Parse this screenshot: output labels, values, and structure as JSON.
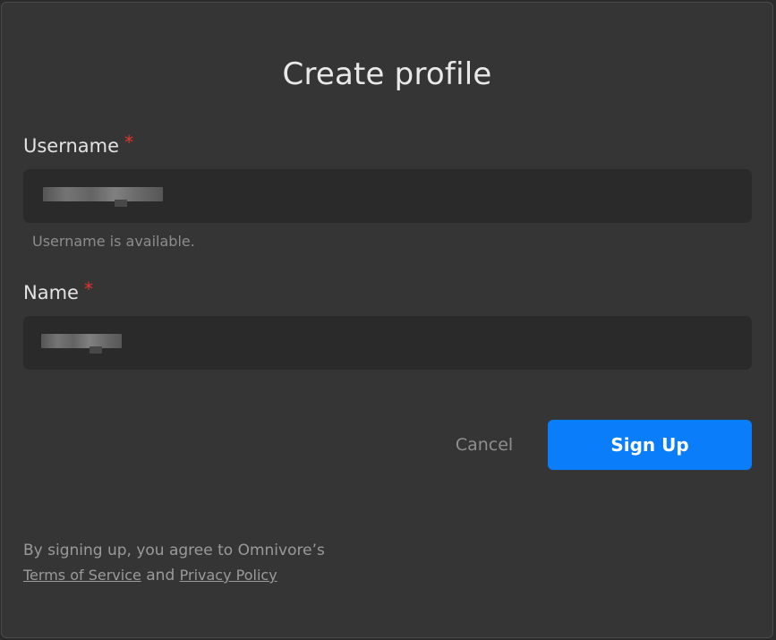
{
  "dialog": {
    "title": "Create profile"
  },
  "form": {
    "username": {
      "label": "Username",
      "required_mark": "*",
      "hint": "Username is available."
    },
    "name": {
      "label": "Name",
      "required_mark": "*"
    }
  },
  "actions": {
    "cancel_label": "Cancel",
    "signup_label": "Sign Up"
  },
  "legal": {
    "prefix": "By signing up, you agree to Omnivore’s",
    "terms_label": "Terms of Service",
    "conjunction": "and",
    "privacy_label": "Privacy Policy"
  },
  "colors": {
    "accent": "#0a7dfa",
    "required": "#e5332a"
  }
}
